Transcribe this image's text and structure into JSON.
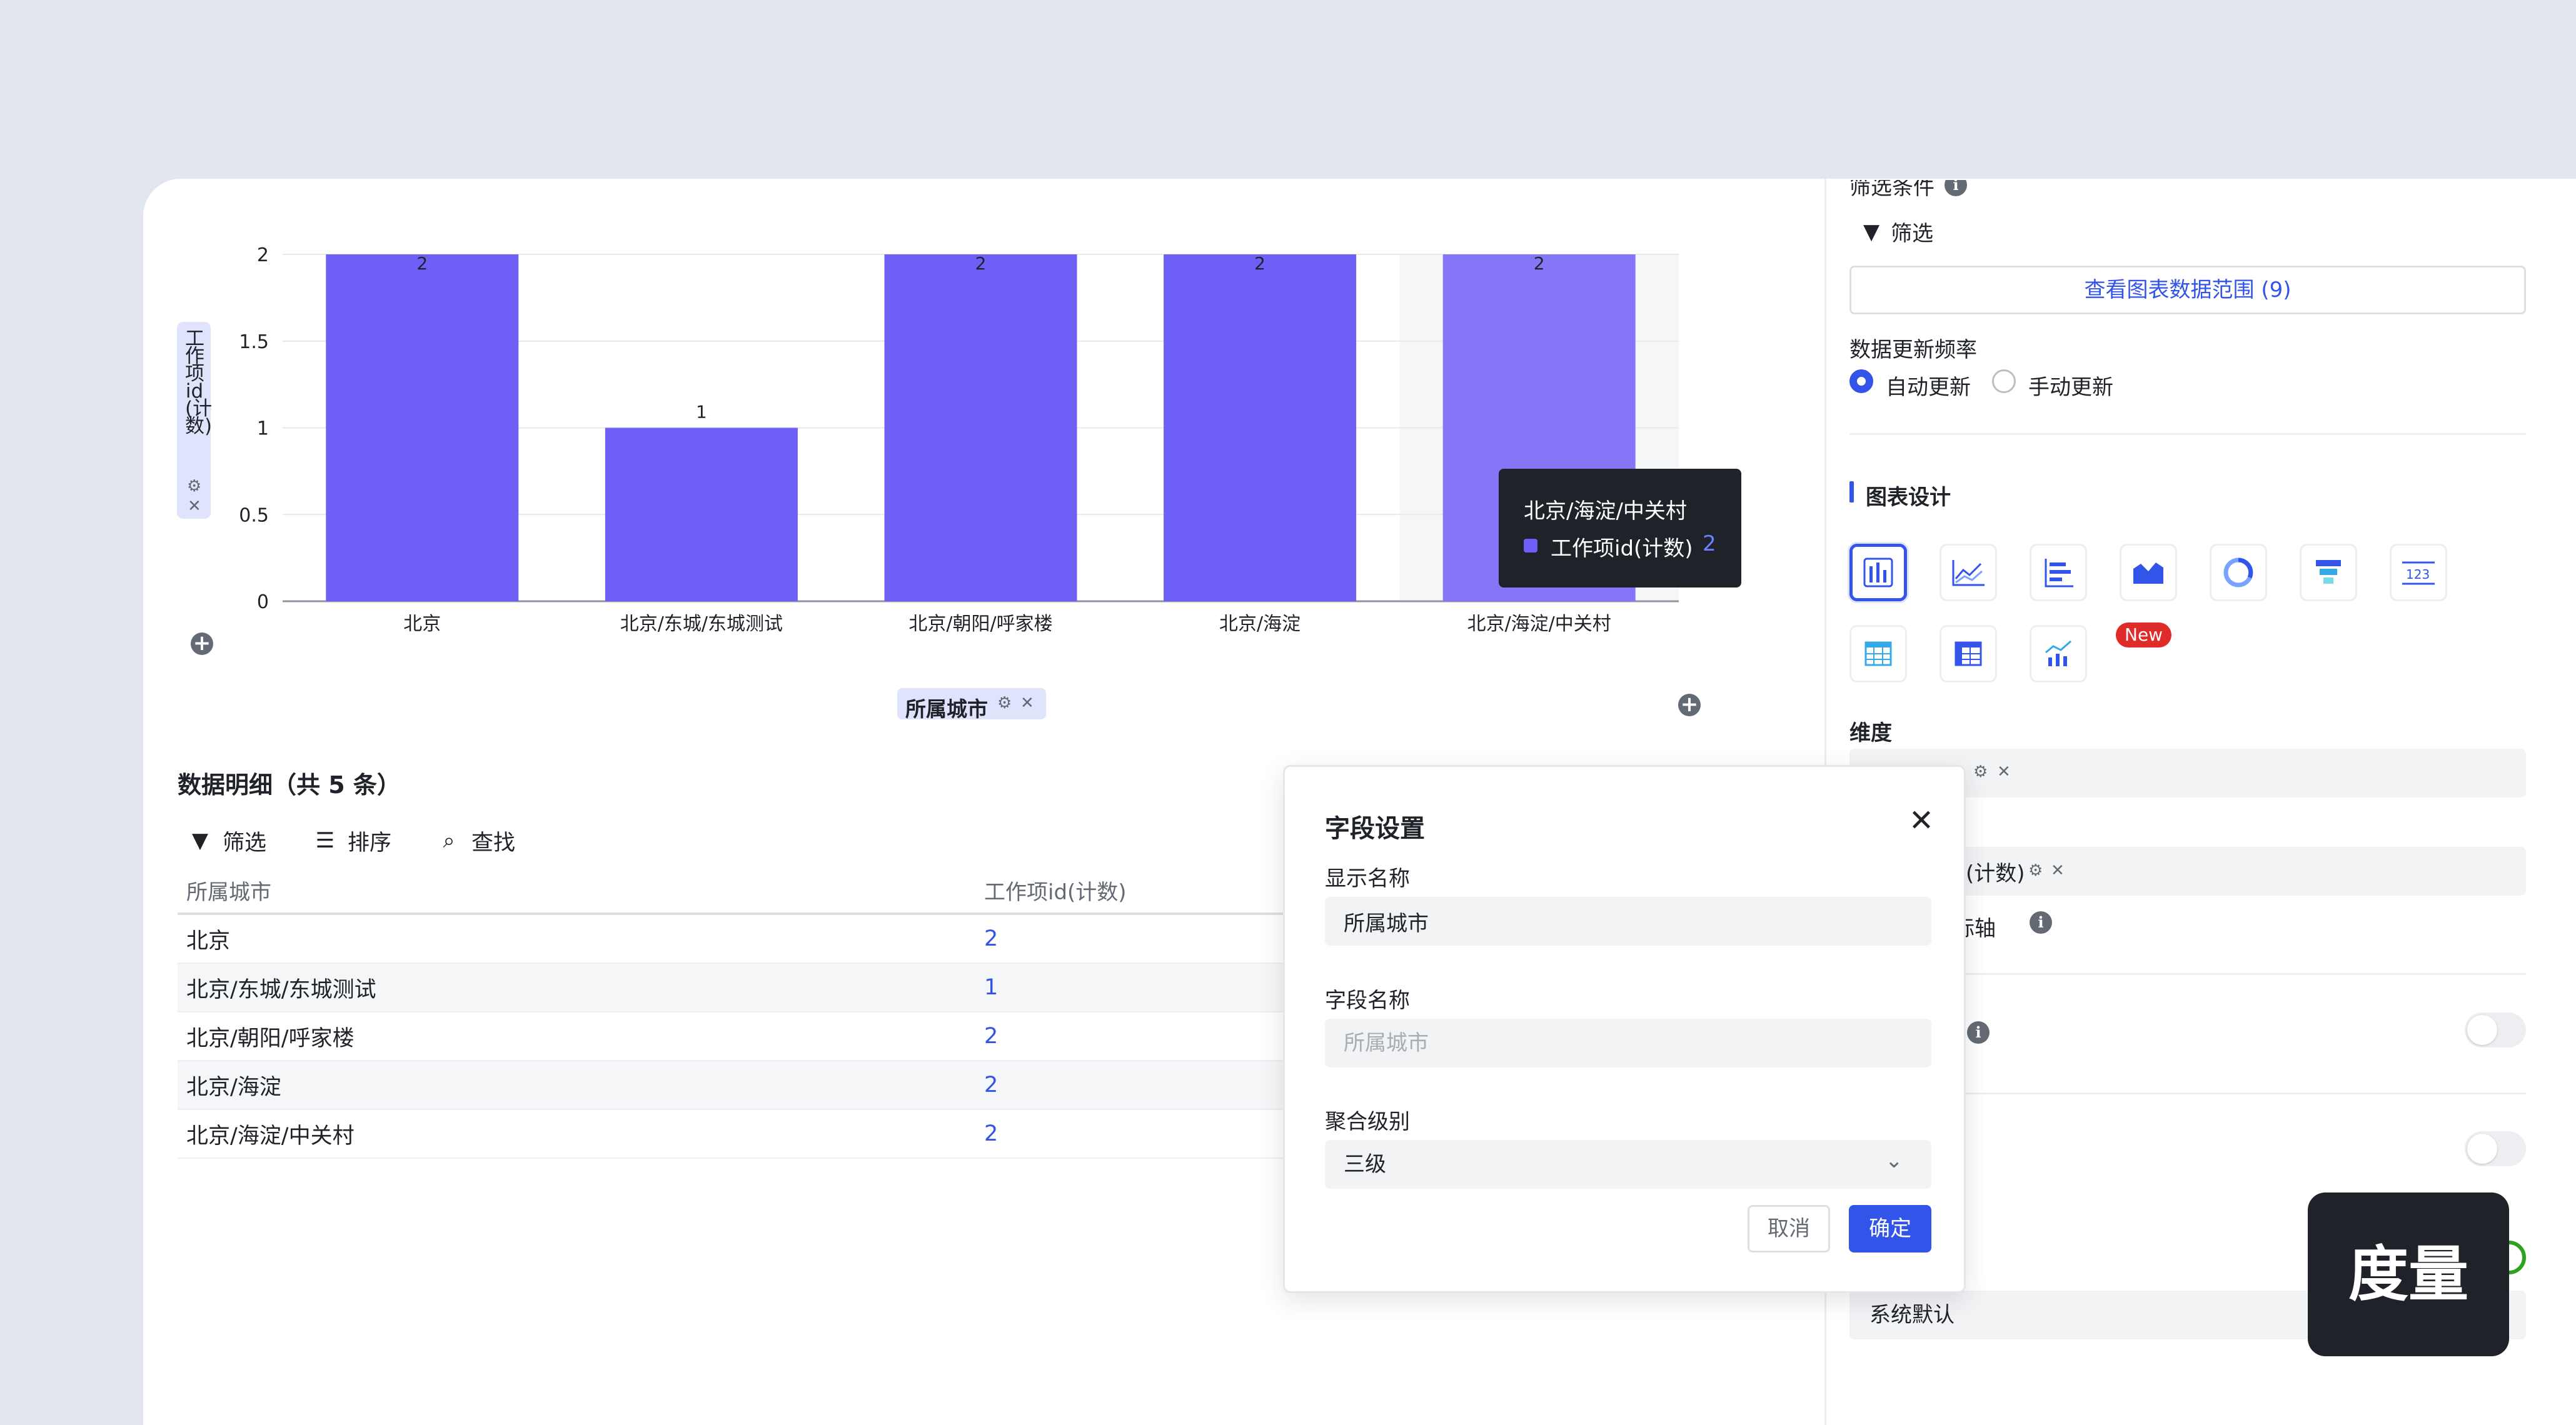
{
  "chart_data": {
    "type": "bar",
    "categories": [
      "北京",
      "北京/东城/东城测试",
      "北京/朝阳/呼家楼",
      "北京/海淀",
      "北京/海淀/中关村"
    ],
    "values": [
      2,
      1,
      2,
      2,
      2
    ],
    "ylabel": "工作项id(计数)",
    "xlabel": "所属城市",
    "ylim": [
      0,
      2
    ],
    "yticks": [
      "0",
      "0.5",
      "1",
      "1.5",
      "2"
    ],
    "data_labels": [
      "2",
      "1",
      "2",
      "2",
      "2"
    ],
    "grid": true,
    "highlighted_index": 4,
    "colors": {
      "bar": "#6e5ff6",
      "bar_hover": "#8576f7",
      "hover_band": "#f5f6f7",
      "grid": "#e8e9eb"
    }
  },
  "tooltip": {
    "title": "北京/海淀/中关村",
    "series": "工作项id(计数)",
    "value": "2",
    "swatch_color": "#6e5ff6"
  },
  "chart_labels": {
    "ylabel": "工作项id(计数)",
    "xlabel": "所属城市"
  },
  "detail": {
    "title": "数据明细（共 5 条）",
    "toolbar": {
      "filter": "筛选",
      "sort": "排序",
      "find": "查找"
    },
    "columns": [
      "所属城市",
      "工作项id(计数)"
    ],
    "rows": [
      {
        "city": "北京",
        "count": "2"
      },
      {
        "city": "北京/东城/东城测试",
        "count": "1"
      },
      {
        "city": "北京/朝阳/呼家楼",
        "count": "2"
      },
      {
        "city": "北京/海淀",
        "count": "2"
      },
      {
        "city": "北京/海淀/中关村",
        "count": "2"
      }
    ]
  },
  "panel": {
    "filter_section": "筛选条件",
    "filter_button": "筛选",
    "view_range": "查看图表数据范围 (9)",
    "update_freq": "数据更新频率",
    "auto_update": "自动更新",
    "manual_update": "手动更新",
    "design_title": "图表设计",
    "chart_types": [
      "bar-chart-icon",
      "line-chart-icon",
      "horizontal-bar-chart-icon",
      "area-chart-icon",
      "donut-chart-icon",
      "funnel-chart-icon",
      "number-card-icon",
      "table-icon",
      "pivot-table-icon",
      "combo-chart-icon"
    ],
    "new_badge": "New",
    "dimension": "维度",
    "measure_tag": "(计数)",
    "axis_label": "标轴",
    "default_value": "系统默认"
  },
  "modal": {
    "title": "字段设置",
    "display_name_label": "显示名称",
    "display_name_value": "所属城市",
    "field_name_label": "字段名称",
    "field_name_placeholder": "所属城市",
    "agg_label": "聚合级别",
    "agg_value": "三级",
    "cancel": "取消",
    "ok": "确定"
  },
  "badge": {
    "label": "度量"
  },
  "colors": {
    "accent": "#3354e8",
    "bar": "#6e5ff6",
    "danger": "#e02b2b",
    "success": "#2ea121"
  }
}
